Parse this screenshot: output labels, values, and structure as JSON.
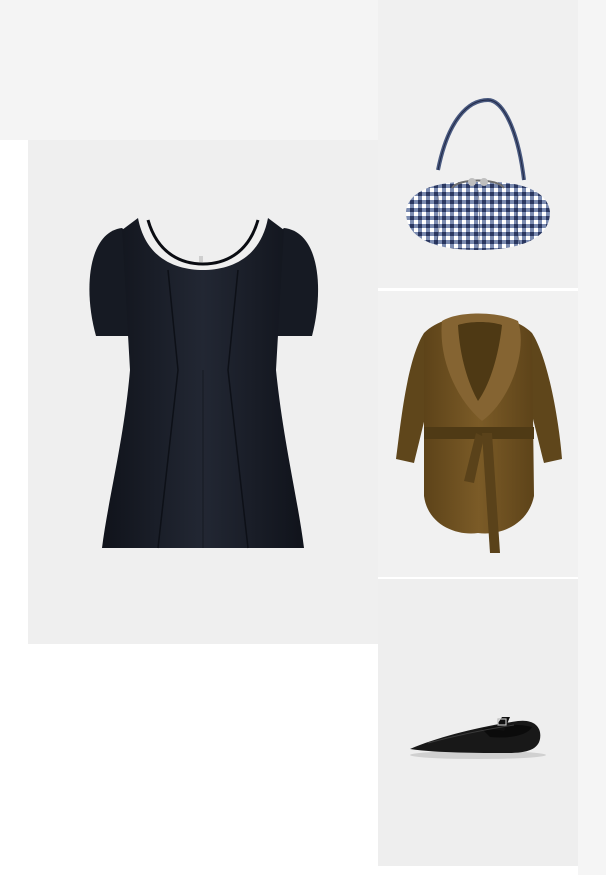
{
  "collage": {
    "items": [
      {
        "name": "dress",
        "color": "#1b1f2a"
      },
      {
        "name": "bag",
        "color": "#4b5a7d"
      },
      {
        "name": "coat",
        "color": "#6b4f23"
      },
      {
        "name": "shoe",
        "color": "#141414"
      }
    ]
  }
}
